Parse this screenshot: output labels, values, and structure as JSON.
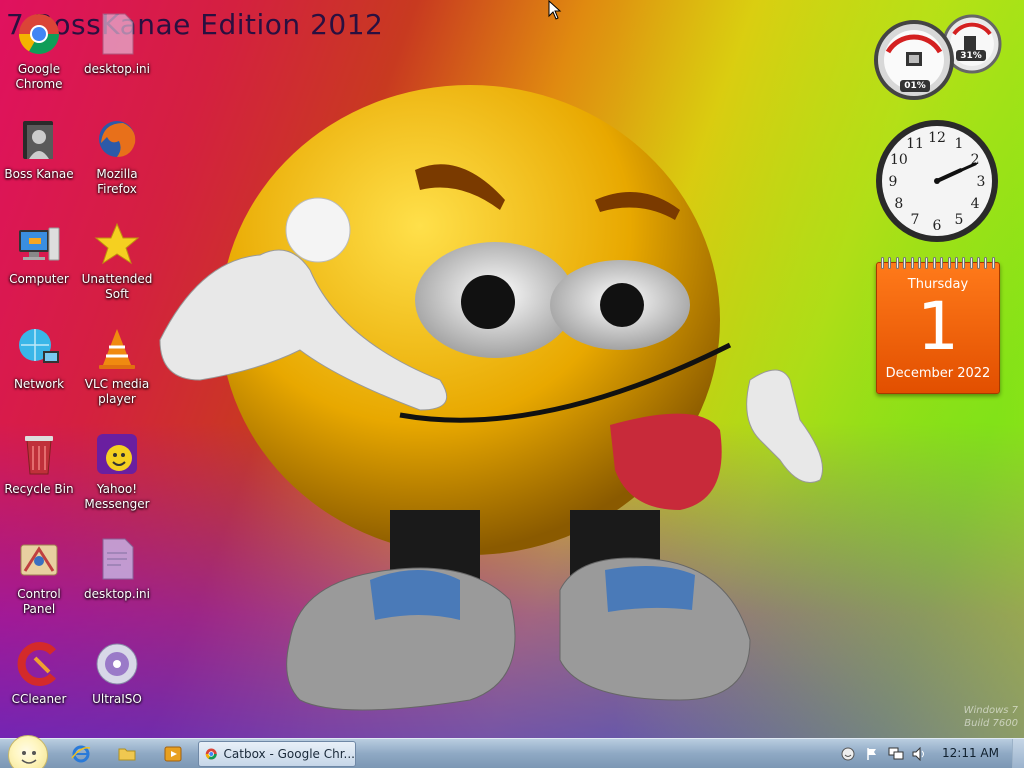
{
  "wallpaper": {
    "title": "7 BossKanae Edition 2012",
    "watermark_line1": "Windows 7",
    "watermark_line2": "Build 7600"
  },
  "desktop_icons": [
    {
      "label": "Google Chrome",
      "icon": "chrome-icon"
    },
    {
      "label": "desktop.ini",
      "icon": "ini-file-icon"
    },
    {
      "label": "Boss Kanae",
      "icon": "user-folder-icon"
    },
    {
      "label": "Mozilla Firefox",
      "icon": "firefox-icon"
    },
    {
      "label": "Computer",
      "icon": "computer-icon"
    },
    {
      "label": "Unattended Soft",
      "icon": "star-icon"
    },
    {
      "label": "Network",
      "icon": "network-icon"
    },
    {
      "label": "VLC media player",
      "icon": "vlc-icon"
    },
    {
      "label": "Recycle Bin",
      "icon": "recycle-bin-icon"
    },
    {
      "label": "Yahoo! Messenger",
      "icon": "yahoo-messenger-icon"
    },
    {
      "label": "Control Panel",
      "icon": "control-panel-icon"
    },
    {
      "label": "desktop.ini",
      "icon": "ini-file-icon"
    },
    {
      "label": "CCleaner",
      "icon": "ccleaner-icon"
    },
    {
      "label": "UltraISO",
      "icon": "disc-icon"
    }
  ],
  "gadgets": {
    "cpu_meter": {
      "cpu": "01%",
      "memory": "31%"
    },
    "clock": {
      "hour": 2,
      "minute": 11,
      "second": 0
    },
    "calendar": {
      "weekday": "Thursday",
      "day": "1",
      "month_year": "December 2022"
    }
  },
  "taskbar": {
    "task_label": "Catbox - Google Chr...",
    "time": "12:11 AM"
  },
  "colors": {
    "calendar_orange": "#ff7a1a",
    "taskbar_blue": "#8fa9c4"
  }
}
